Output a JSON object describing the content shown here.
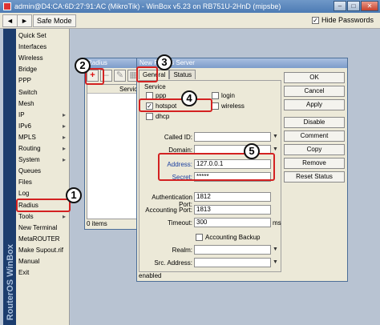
{
  "window": {
    "title": "admin@D4:CA:6D:27:91:AC (MikroTik) - WinBox v5.23 on RB751U-2HnD (mipsbe)",
    "btn_min": "–",
    "btn_max": "□",
    "btn_close": "✕"
  },
  "toolbar": {
    "back": "◄",
    "forward": "►",
    "safe_mode": "Safe Mode",
    "hide_passwords": "Hide Passwords",
    "hide_passwords_mark": "✓"
  },
  "brand": "RouterOS WinBox",
  "menu": {
    "items": [
      {
        "label": "Quick Set",
        "arrow": ""
      },
      {
        "label": "Interfaces",
        "arrow": ""
      },
      {
        "label": "Wireless",
        "arrow": ""
      },
      {
        "label": "Bridge",
        "arrow": ""
      },
      {
        "label": "PPP",
        "arrow": ""
      },
      {
        "label": "Switch",
        "arrow": ""
      },
      {
        "label": "Mesh",
        "arrow": ""
      },
      {
        "label": "IP",
        "arrow": "▸"
      },
      {
        "label": "IPv6",
        "arrow": "▸"
      },
      {
        "label": "MPLS",
        "arrow": "▸"
      },
      {
        "label": "Routing",
        "arrow": "▸"
      },
      {
        "label": "System",
        "arrow": "▸"
      },
      {
        "label": "Queues",
        "arrow": ""
      },
      {
        "label": "Files",
        "arrow": ""
      },
      {
        "label": "Log",
        "arrow": ""
      },
      {
        "label": "Radius",
        "arrow": ""
      },
      {
        "label": "Tools",
        "arrow": "▸"
      },
      {
        "label": "New Terminal",
        "arrow": ""
      },
      {
        "label": "MetaROUTER",
        "arrow": ""
      },
      {
        "label": "Make Supout.rif",
        "arrow": ""
      },
      {
        "label": "Manual",
        "arrow": ""
      },
      {
        "label": "Exit",
        "arrow": ""
      }
    ]
  },
  "radius_window": {
    "title": "Radius",
    "add": "+",
    "remove": "–",
    "edit": "✎",
    "filter": "▦",
    "column": "Service",
    "status": "0 items"
  },
  "new_radius": {
    "title": "New Radius Server",
    "tabs": [
      "General",
      "Status"
    ],
    "service_label": "Service",
    "services": {
      "ppp": {
        "label": "ppp",
        "mark": ""
      },
      "login": {
        "label": "login",
        "mark": ""
      },
      "hotspot": {
        "label": "hotspot",
        "mark": "✓"
      },
      "wireless": {
        "label": "wireless",
        "mark": ""
      },
      "dhcp": {
        "label": "dhcp",
        "mark": ""
      }
    },
    "fields": {
      "called_id": {
        "label": "Called ID:",
        "value": ""
      },
      "domain": {
        "label": "Domain:",
        "value": ""
      },
      "address": {
        "label": "Address:",
        "value": "127.0.0.1"
      },
      "secret": {
        "label": "Secret:",
        "value": "*****"
      },
      "auth_port": {
        "label": "Authentication Port:",
        "value": "1812"
      },
      "acct_port": {
        "label": "Accounting Port:",
        "value": "1813"
      },
      "timeout": {
        "label": "Timeout:",
        "value": "300",
        "unit": "ms"
      },
      "realm": {
        "label": "Realm:",
        "value": ""
      },
      "src_address": {
        "label": "Src. Address:",
        "value": ""
      }
    },
    "accounting_backup": {
      "label": "Accounting Backup",
      "mark": ""
    },
    "buttons": [
      "OK",
      "Cancel",
      "Apply",
      "Disable",
      "Comment",
      "Copy",
      "Remove",
      "Reset Status"
    ],
    "status": "enabled"
  },
  "callouts": [
    "1",
    "2",
    "3",
    "4",
    "5"
  ],
  "colors": {
    "highlight": "#d32121",
    "sidebar": "#1c3d6e"
  }
}
